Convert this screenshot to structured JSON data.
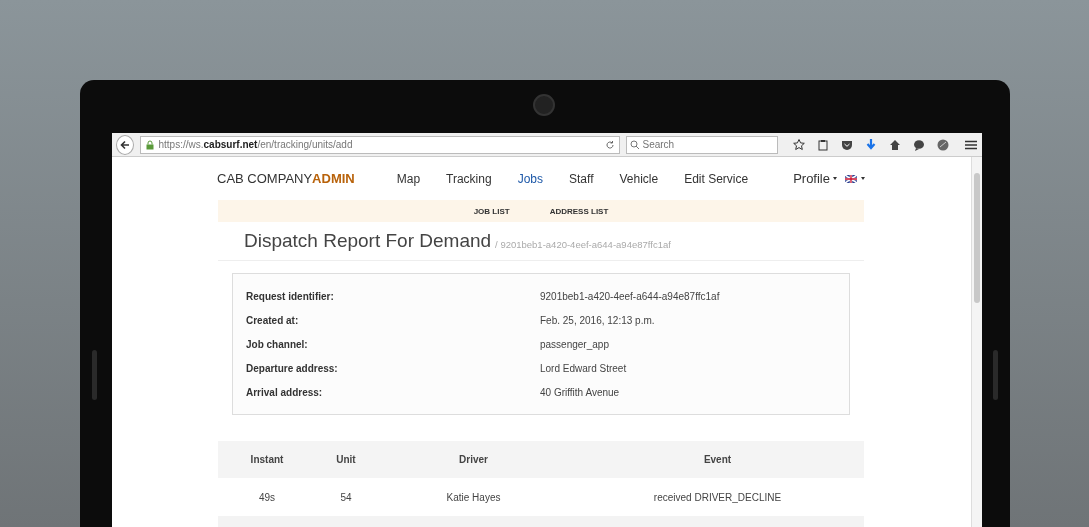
{
  "browser": {
    "url": "https://ws.**cabsurf.net**/en/tracking/units/add",
    "search": {
      "placeholder": "Search"
    }
  },
  "navbar": {
    "brand": "CAB COMPANY**ADMIN**",
    "items": [
      {
        "label": "Map",
        "selected": false
      },
      {
        "label": "Tracking",
        "selected": false
      },
      {
        "label": "Jobs",
        "selected": true
      },
      {
        "label": "Staff",
        "selected": false
      },
      {
        "label": "Vehicle",
        "selected": false
      },
      {
        "label": "Edit Service",
        "selected": false
      }
    ],
    "profile": "Profile"
  },
  "subnav": [
    "JOB LIST",
    "ADDRESS LIST"
  ],
  "header": {
    "title": "Dispatch Report For Demand",
    "subtitle": "/ 9201beb1-a420-4eef-a644-a94e87ffc1af"
  },
  "details": [
    {
      "label": "Request identifier:",
      "value": "9201beb1-a420-4eef-a644-a94e87ffc1af"
    },
    {
      "label": "Created at:",
      "value": "Feb. 25, 2016, 12:13 p.m."
    },
    {
      "label": "Job channel:",
      "value": "passenger_app"
    },
    {
      "label": "Departure address:",
      "value": "Lord Edward Street"
    },
    {
      "label": "Arrival address:",
      "value": "40 Griffith Avenue"
    }
  ],
  "table": {
    "columns": [
      "Instant",
      "Unit",
      "Driver",
      "Event"
    ],
    "rows": [
      [
        "49s",
        "54",
        "Katie Hayes",
        "received DRIVER_DECLINE"
      ]
    ]
  }
}
